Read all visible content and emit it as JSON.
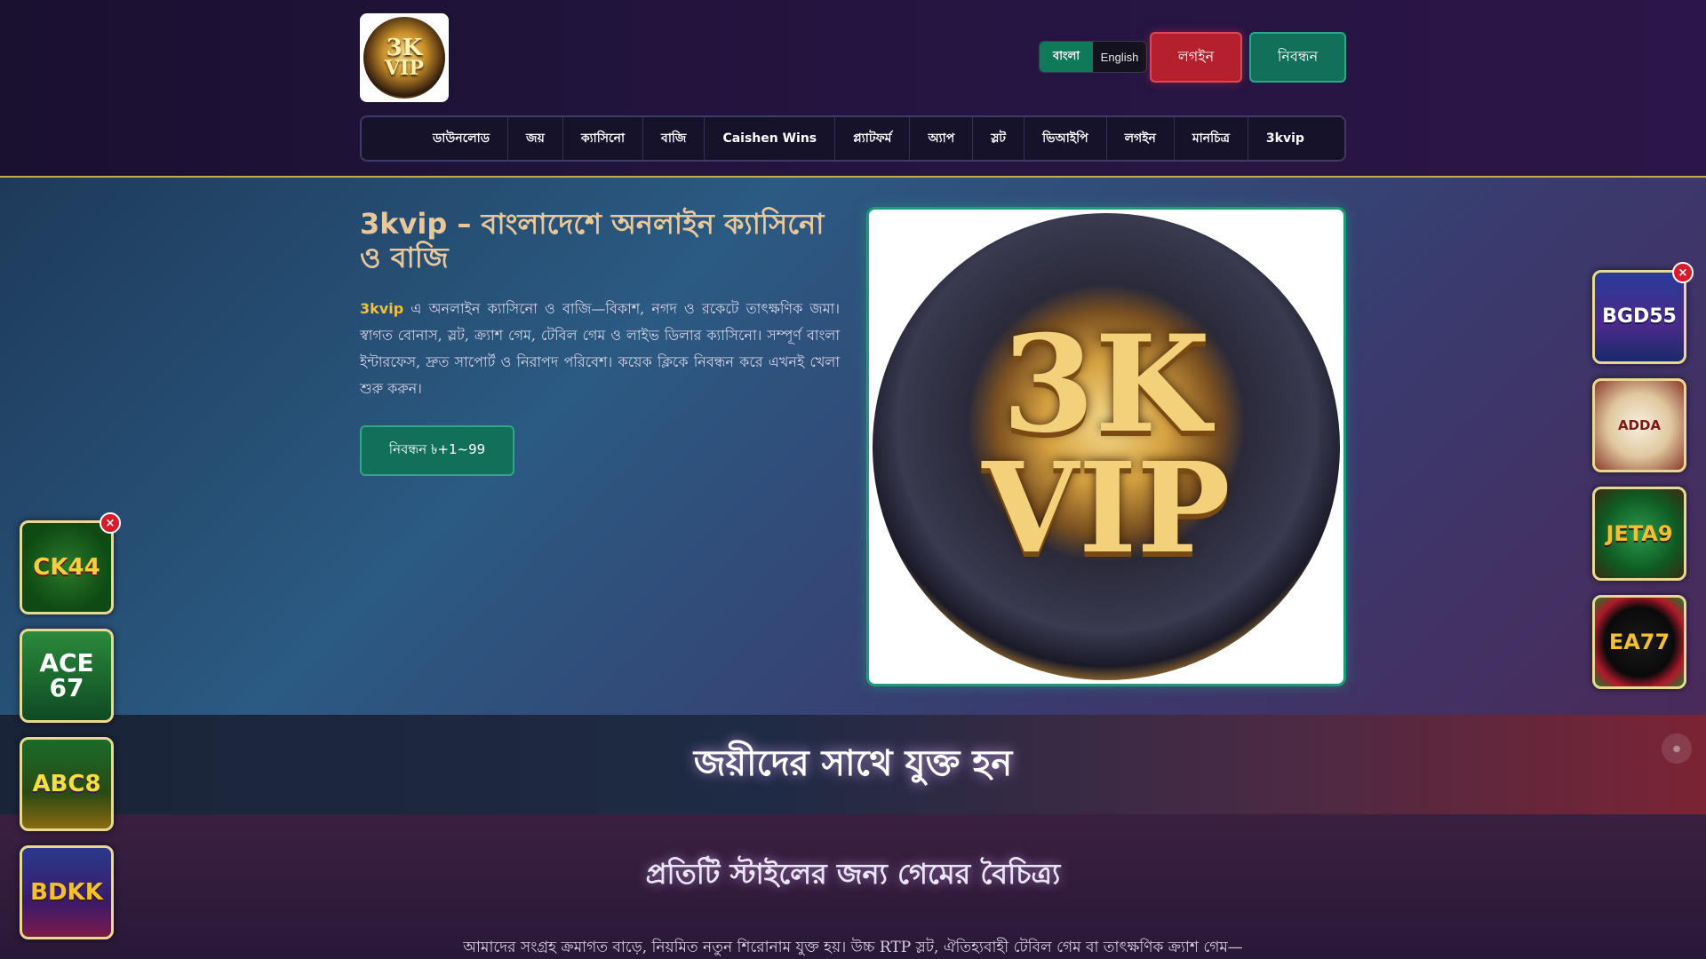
{
  "header": {
    "logo_alt": "3K VIP",
    "lang": {
      "active": "বাংলা",
      "inactive": "English"
    },
    "login_label": "লগইন",
    "register_label": "নিবন্ধন"
  },
  "nav": {
    "items": [
      "ডাউনলোড",
      "জয়",
      "ক্যাসিনো",
      "বাজি",
      "Caishen Wins",
      "প্ল্যাটফর্ম",
      "অ্যাপ",
      "স্লট",
      "ভিআইপি",
      "লগইন",
      "মানচিত্র",
      "3kvip"
    ]
  },
  "hero": {
    "title": "3kvip – বাংলাদেশে অনলাইন ক্যাসিনো ও বাজি",
    "brand": "3kvip",
    "text": " এ অনলাইন ক্যাসিনো ও বাজি—বিকাশ, নগদ ও রকেটে তাৎক্ষণিক জমা। স্বাগত বোনাস, স্লট, ক্র্যাশ গেম, টেবিল গেম ও লাইভ ডিলার ক্যাসিনো। সম্পূর্ণ বাংলা ইন্টারফেস, দ্রুত সাপোর্ট ও নিরাপদ পরিবেশ। কয়েক ক্লিকে নিবন্ধন করে এখনই খেলা শুরু করুন।",
    "button_label": "নিবন্ধন ৳+1~99",
    "image_text_1": "3K",
    "image_text_2": "VIP"
  },
  "banner": {
    "title": "জয়ীদের সাথে যুক্ত হন"
  },
  "lower": {
    "title": "প্রতিটি স্টাইলের জন্য গেমের বৈচিত্র্য",
    "text": "আমাদের সংগ্রহ ক্রমাগত বাড়ে, নিয়মিত নতুন শিরোনাম যুক্ত হয়। উচ্চ RTP স্লট, ঐতিহ্যবাহী টেবিল গেম বা তাৎক্ষণিক ক্র্যাশ গেম—"
  },
  "left_apps": [
    "CK44",
    "ACE 67",
    "ABC8",
    "BDKK"
  ],
  "right_apps": [
    "BGD55",
    "ADDA",
    "JETA9",
    "EA77"
  ],
  "close_symbol": "×",
  "colors": {
    "accent_green": "#12705a",
    "accent_red": "#b5202e",
    "gold": "#c9a94a"
  }
}
